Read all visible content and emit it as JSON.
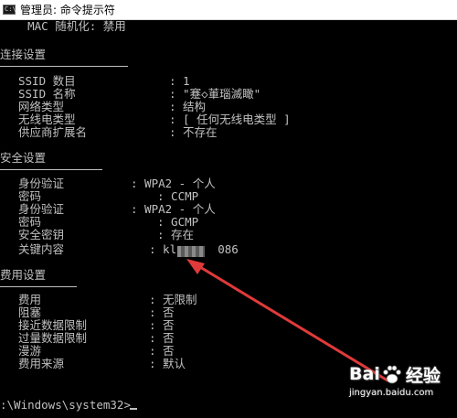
{
  "window": {
    "title": "管理员: 命令提示符",
    "icon_text": "C:\\"
  },
  "console": {
    "mac_line": "    MAC 随机化: 禁用",
    "connection": {
      "header": "连接设置",
      "items": [
        {
          "key": "SSID 数目",
          "value": ": 1"
        },
        {
          "key": "SSID 名称",
          "value": ": \"蹇◇莗瑙滅瞰\""
        },
        {
          "key": "网络类型",
          "value": ": 结构"
        },
        {
          "key": "无线电类型",
          "value": ": [ 任何无线电类型 ]"
        },
        {
          "key": "供应商扩展名",
          "value": ": 不存在"
        }
      ]
    },
    "security": {
      "header": "安全设置",
      "items": [
        {
          "key": "身份验证",
          "value": ": WPA2 - 个人"
        },
        {
          "key": "密码",
          "value": ": CCMP"
        },
        {
          "key": "身份验证",
          "value": ": WPA2 - 个人"
        },
        {
          "key": "密码",
          "value": ": GCMP"
        },
        {
          "key": "安全密钥",
          "value": ": 存在"
        },
        {
          "key": "关键内容",
          "value": ": kl      086"
        }
      ]
    },
    "cost": {
      "header": "费用设置",
      "items": [
        {
          "key": "费用",
          "value": ": 无限制"
        },
        {
          "key": "阻塞",
          "value": ": 否"
        },
        {
          "key": "接近数据限制",
          "value": ": 否"
        },
        {
          "key": "过量数据限制",
          "value": ": 否"
        },
        {
          "key": "漫游",
          "value": ": 否"
        },
        {
          "key": "费用来源",
          "value": ": 默认"
        }
      ]
    },
    "prompt": ":\\Windows\\system32>"
  },
  "watermark": {
    "brand": "Bai",
    "brand_suffix": "经验",
    "url": "jingyan.baidu.com"
  },
  "colors": {
    "console_bg": "#000000",
    "console_text": "#c0c0c0",
    "arrow": "#e03a3a"
  }
}
